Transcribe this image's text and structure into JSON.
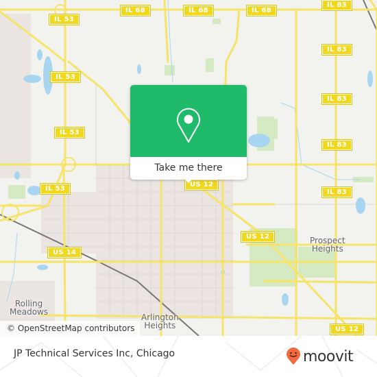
{
  "map": {
    "attribution": "© OpenStreetMap contributors",
    "road_shields": [
      {
        "label": "IL 68",
        "id": "il68-a"
      },
      {
        "label": "IL 68",
        "id": "il68-b"
      },
      {
        "label": "IL 68",
        "id": "il68-c"
      },
      {
        "label": "IL 53",
        "id": "il53-a"
      },
      {
        "label": "IL 53",
        "id": "il53-b"
      },
      {
        "label": "IL 53",
        "id": "il53-c"
      },
      {
        "label": "IL 53",
        "id": "il53-d"
      },
      {
        "label": "IL 83",
        "id": "il83-a"
      },
      {
        "label": "IL 83",
        "id": "il83-b"
      },
      {
        "label": "IL 83",
        "id": "il83-c"
      },
      {
        "label": "IL 83",
        "id": "il83-d"
      },
      {
        "label": "IL 83",
        "id": "il83-e"
      },
      {
        "label": "US 12",
        "id": "us12-a"
      },
      {
        "label": "US 12",
        "id": "us12-b"
      },
      {
        "label": "US 12",
        "id": "us12-c"
      },
      {
        "label": "US 14",
        "id": "us14-a"
      }
    ],
    "places": [
      {
        "name_line1": "Prospect",
        "name_line2": "Heights"
      },
      {
        "name_line1": "Rolling",
        "name_line2": "Meadows"
      },
      {
        "name_line1": "Arlington",
        "name_line2": "Heights"
      }
    ],
    "colors": {
      "background": "#f2f2ee",
      "road": "#f6e46a",
      "road_casing": "#e8d45a",
      "water": "#a8d6f0",
      "park": "#d6ebc4",
      "urban": "#ebe5e3"
    }
  },
  "popup": {
    "icon": "map-pin-icon",
    "action_label": "Take me there",
    "accent_color": "#1fbb6a"
  },
  "footer": {
    "business_name": "JP Technical Services Inc, Chicago",
    "brand_name": "moovit",
    "brand_icon": "moovit-pin-smile-icon",
    "brand_color": "#f26a3d"
  }
}
